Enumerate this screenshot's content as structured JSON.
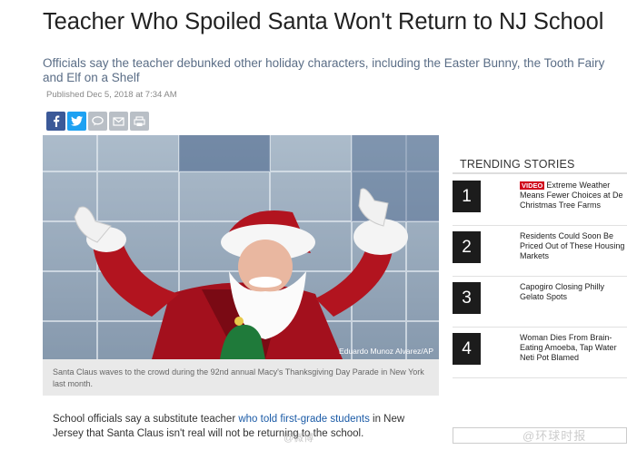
{
  "article": {
    "headline": "Teacher Who Spoiled Santa Won't Return to NJ School",
    "dek": "Officials say the teacher debunked other holiday characters, including the Easter Bunny, the Tooth Fairy and Elf on a Shelf",
    "published": "Published Dec 5, 2018 at 7:34 AM",
    "photo_credit": "Eduardo Munoz Alvarez/AP",
    "caption": "Santa Claus waves to the crowd during the 92nd annual Macy's Thanksgiving Day Parade in New York last month.",
    "body_before": "School officials say a substitute teacher ",
    "body_link": "who told first-grade students",
    "body_after": " in New Jersey that Santa Claus isn't real will not be returning to the school."
  },
  "share": {
    "icons": [
      "facebook-icon",
      "twitter-icon",
      "comment-icon",
      "email-icon",
      "print-icon"
    ],
    "colors": {
      "facebook": "#3b5998",
      "twitter": "#1da1f2",
      "neutral": "#b9bfc6"
    }
  },
  "trending": {
    "title": "TRENDING STORIES",
    "items": [
      {
        "number": "1",
        "badge": "VIDEO",
        "text": "Extreme Weather Means Fewer Choices at De Christmas Tree Farms"
      },
      {
        "number": "2",
        "badge": "",
        "text": "Residents Could Soon Be Priced Out of These Housing Markets"
      },
      {
        "number": "3",
        "badge": "",
        "text": "Capogiro Closing Philly Gelato Spots"
      },
      {
        "number": "4",
        "badge": "",
        "text": "Woman Dies From Brain-Eating Amoeba, Tap Water Neti Pot Blamed"
      }
    ]
  },
  "watermark": {
    "text": "@环球时报",
    "small": "@微博"
  },
  "colors": {
    "link": "#1a5aa6",
    "dek": "#5a6d86",
    "badge": "#d0021b"
  }
}
